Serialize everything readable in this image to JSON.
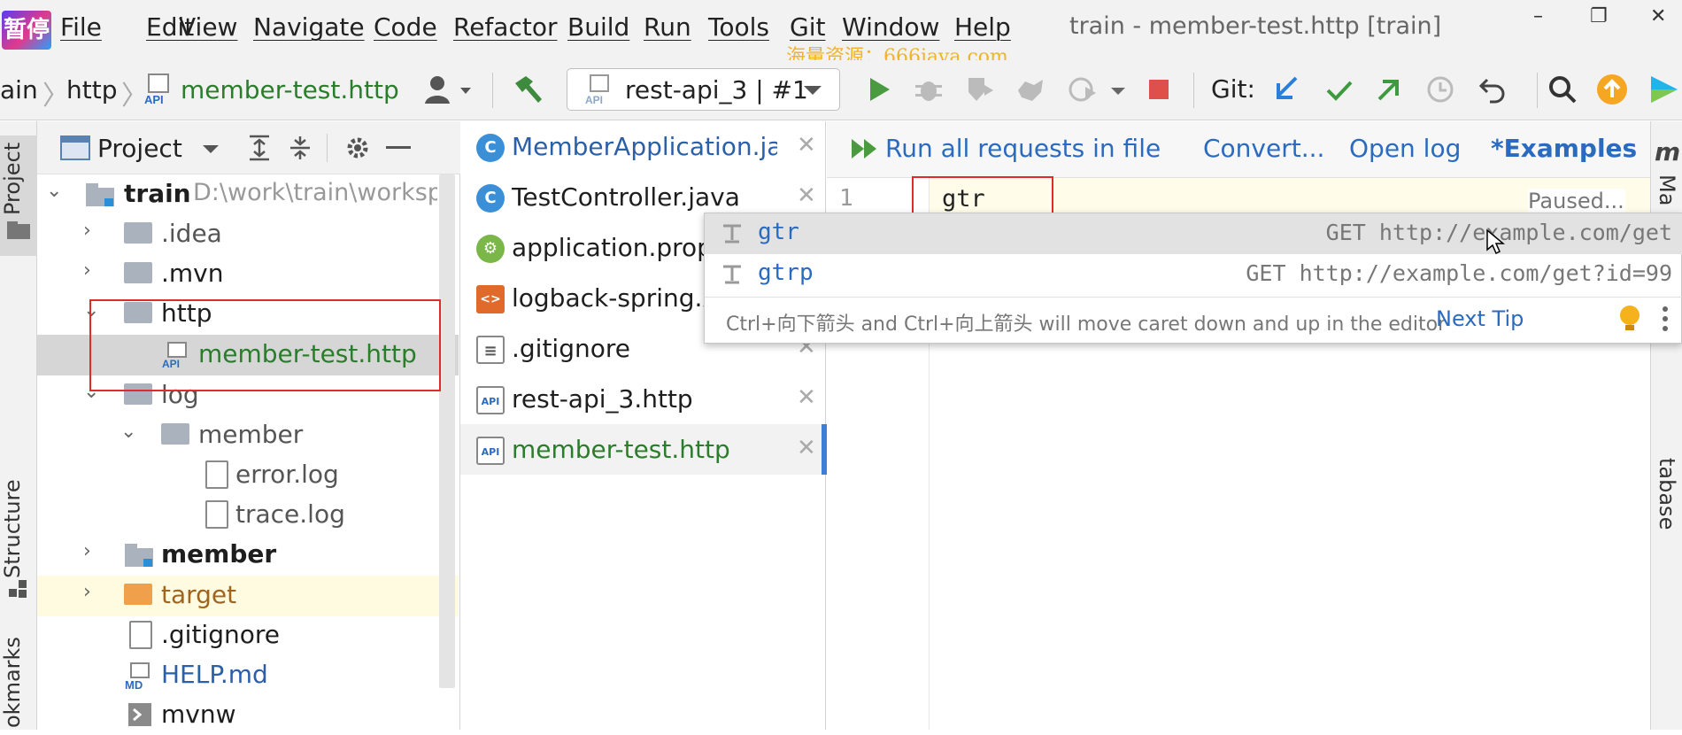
{
  "logo_text": "暂停",
  "menu": [
    "File",
    "Edit",
    "View",
    "Navigate",
    "Code",
    "Refactor",
    "Build",
    "Run",
    "Tools",
    "Git",
    "Window",
    "Help"
  ],
  "window_title": "train - member-test.http [train]",
  "watermark": "海量资源：666java.com",
  "window_controls": {
    "minimize": "–",
    "restore": "❐",
    "close": "✕"
  },
  "breadcrumb": {
    "project": "ain",
    "folder": "http",
    "file": "member-test.http",
    "sep": "〉"
  },
  "run_config": {
    "label": "rest-api_3 | #1"
  },
  "git_label": "Git:",
  "left_strip": {
    "project": "Project",
    "structure": "Structure",
    "bookmarks": "okmarks"
  },
  "project_panel": {
    "title": "Project",
    "tree": [
      {
        "label": "train",
        "path": "D:\\work\\train\\workspace",
        "kind": "module-root"
      },
      {
        "label": ".idea",
        "kind": "folder"
      },
      {
        "label": ".mvn",
        "kind": "folder"
      },
      {
        "label": "http",
        "kind": "folder"
      },
      {
        "label": "member-test.http",
        "kind": "api-file"
      },
      {
        "label": "log",
        "kind": "folder"
      },
      {
        "label": "member",
        "kind": "folder"
      },
      {
        "label": "error.log",
        "kind": "file"
      },
      {
        "label": "trace.log",
        "kind": "file"
      },
      {
        "label": "member",
        "kind": "module"
      },
      {
        "label": "target",
        "kind": "folder-orange"
      },
      {
        "label": ".gitignore",
        "kind": "file"
      },
      {
        "label": "HELP.md",
        "kind": "md-file"
      },
      {
        "label": "mvnw",
        "kind": "exe-file"
      }
    ]
  },
  "editor_tabs": [
    {
      "label": "MemberApplication.java",
      "icon": "C",
      "color": "#2b5fa8"
    },
    {
      "label": "TestController.java",
      "icon": "C",
      "color": "#222"
    },
    {
      "label": "application.properties",
      "icon": "⚙",
      "color": "#222"
    },
    {
      "label": "logback-spring.xml",
      "icon": "<>",
      "color": "#222"
    },
    {
      "label": ".gitignore",
      "icon": "≡",
      "color": "#222"
    },
    {
      "label": "rest-api_3.http",
      "icon": "API",
      "color": "#222"
    },
    {
      "label": "member-test.http",
      "icon": "API",
      "color": "#2a7d2a"
    }
  ],
  "editor_toolbar": {
    "run_all": "Run all requests in file",
    "convert": "Convert...",
    "open_log": "Open log",
    "examples": "*Examples"
  },
  "editor": {
    "line_number": "1",
    "code": "gtr",
    "paused": "Paused..."
  },
  "right_strip": {
    "maven": "Ma",
    "database": "tabase",
    "logo": "m"
  },
  "completion_popup": {
    "items": [
      {
        "name": "gtr",
        "value": "GET http://example.com/get"
      },
      {
        "name": "gtrp",
        "value": "GET http://example.com/get?id=99"
      }
    ],
    "hint": "Ctrl+向下箭头 and Ctrl+向上箭头 will move caret down and up in the editor",
    "next_tip": "Next Tip"
  }
}
